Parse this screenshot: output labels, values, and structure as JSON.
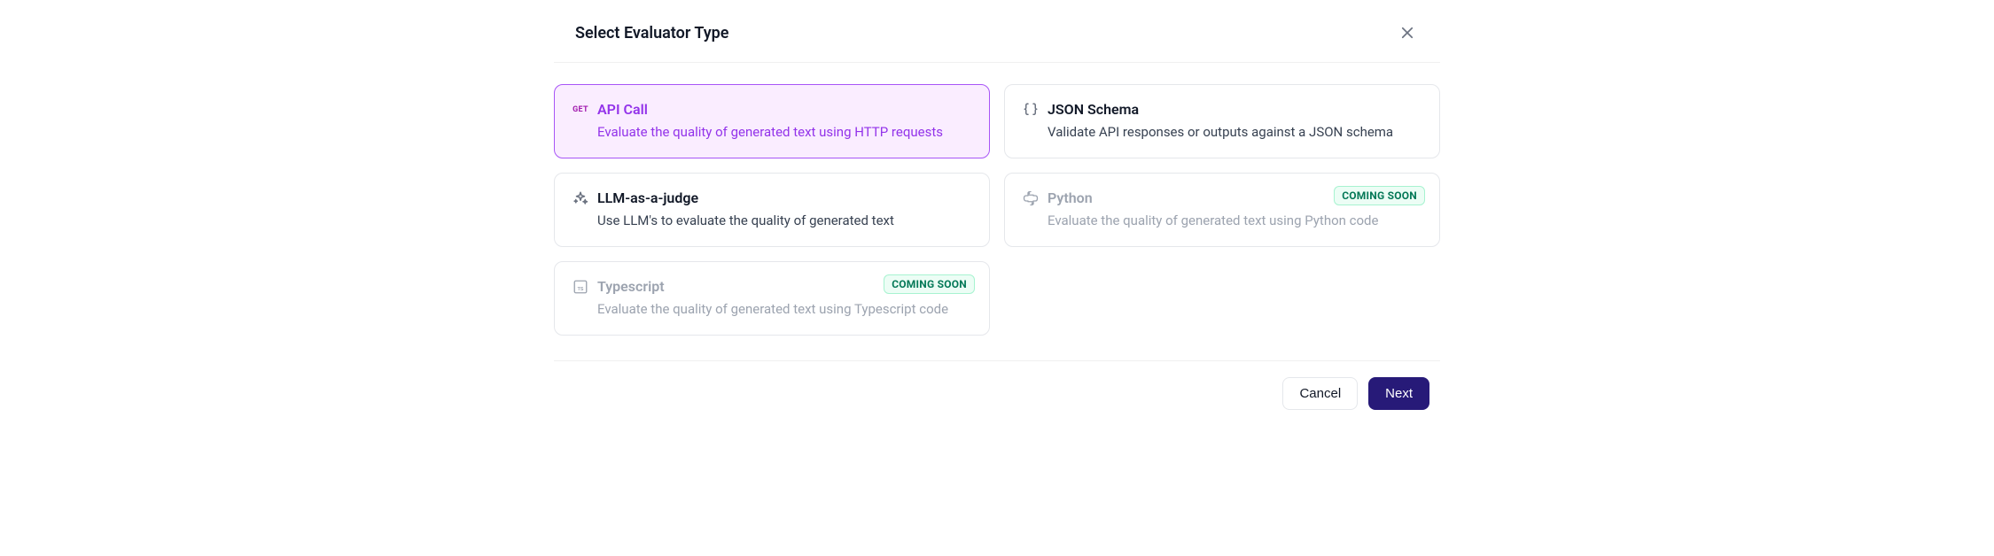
{
  "modal": {
    "title": "Select Evaluator Type"
  },
  "options": {
    "api_call": {
      "icon_text": "GET",
      "title": "API Call",
      "desc": "Evaluate the quality of generated text using HTTP requests"
    },
    "json_schema": {
      "title": "JSON Schema",
      "desc": "Validate API responses or outputs against a JSON schema"
    },
    "llm_judge": {
      "title": "LLM-as-a-judge",
      "desc": "Use LLM's to evaluate the quality of generated text"
    },
    "python": {
      "title": "Python",
      "desc": "Evaluate the quality of generated text using Python code",
      "badge": "COMING SOON"
    },
    "typescript": {
      "title": "Typescript",
      "desc": "Evaluate the quality of generated text using Typescript code",
      "badge": "COMING SOON"
    }
  },
  "footer": {
    "cancel": "Cancel",
    "next": "Next"
  }
}
